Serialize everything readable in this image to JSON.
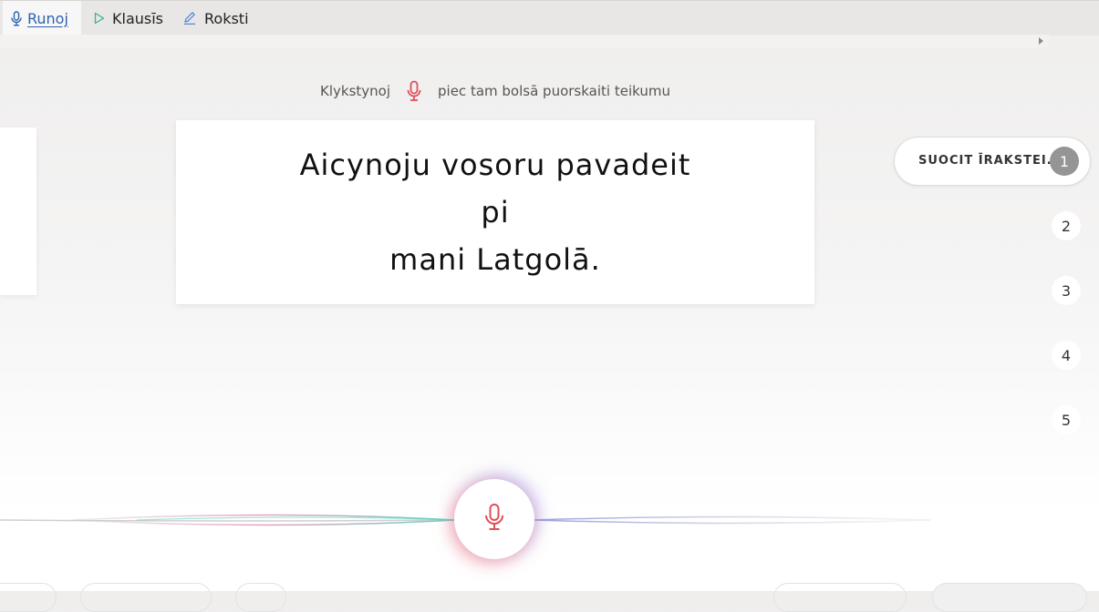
{
  "tabs": [
    {
      "label": "Runoj",
      "icon": "mic-icon",
      "active": true
    },
    {
      "label": "Klausīs",
      "icon": "play-icon",
      "active": false
    },
    {
      "label": "Roksti",
      "icon": "pencil-icon",
      "active": false
    }
  ],
  "instruction": {
    "before": "Klykstynoj",
    "after": "piec tam bolsā puorskaiti teikumu"
  },
  "sentence": {
    "line1": "Aicynoju vosoru pavadeit pi",
    "line2": "mani Latgolā."
  },
  "steps": {
    "submit_label": "SUOCIT ĪRAKSTEI...",
    "current": "1",
    "others": [
      "2",
      "3",
      "4",
      "5"
    ]
  },
  "colors": {
    "accent": "#2f62b0",
    "mic": "#e0505a",
    "current_step": "#959595"
  }
}
